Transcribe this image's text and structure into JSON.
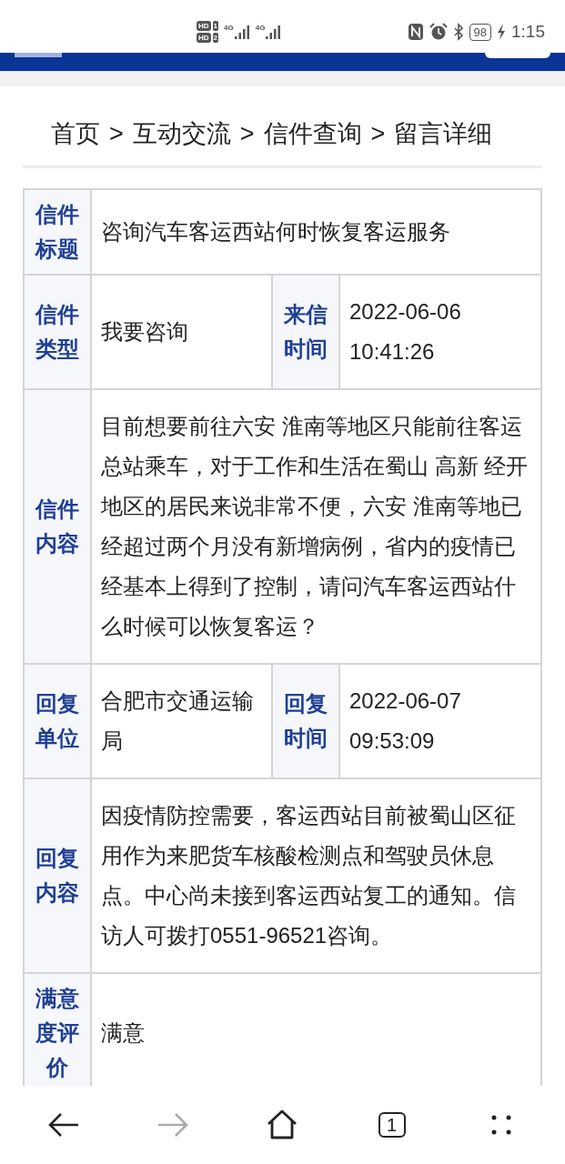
{
  "status_bar": {
    "sims": [
      {
        "label": "HD",
        "slot": "1"
      },
      {
        "label": "HD",
        "slot": "2"
      }
    ],
    "networks": [
      "4G",
      "4G"
    ],
    "battery": "98",
    "charging": true,
    "time": "1:15"
  },
  "breadcrumb": {
    "items": [
      "首页",
      "互动交流",
      "信件查询",
      "留言详细"
    ],
    "separator": ">"
  },
  "details": {
    "rows": [
      {
        "cells": [
          {
            "kind": "label",
            "text": "信件标题"
          },
          {
            "kind": "value",
            "text": "咨询汽车客运西站何时恢复客运服务"
          }
        ]
      },
      {
        "cells": [
          {
            "kind": "label",
            "text": "信件类型"
          },
          {
            "kind": "value",
            "text": "我要咨询"
          },
          {
            "kind": "label",
            "text": "来信时间"
          },
          {
            "kind": "datetime",
            "text": "2022-06-06 10:41:26"
          }
        ]
      },
      {
        "cells": [
          {
            "kind": "label",
            "text": "信件内容"
          },
          {
            "kind": "value",
            "text": "目前想要前往六安 淮南等地区只能前往客运总站乘车，对于工作和生活在蜀山 高新 经开地区的居民来说非常不便，六安 淮南等地已经超过两个月没有新增病例，省内的疫情已经基本上得到了控制，请问汽车客运西站什么时候可以恢复客运？"
          }
        ]
      },
      {
        "cells": [
          {
            "kind": "label",
            "text": "回复单位"
          },
          {
            "kind": "value",
            "text": "合肥市交通运输局"
          },
          {
            "kind": "label",
            "text": "回复时间"
          },
          {
            "kind": "datetime",
            "text": "2022-06-07 09:53:09"
          }
        ]
      },
      {
        "cells": [
          {
            "kind": "label",
            "text": "回复内容"
          },
          {
            "kind": "value",
            "text": "因疫情防控需要，客运西站目前被蜀山区征用作为来肥货车核酸检测点和驾驶员休息点。中心尚未接到客运西站复工的通知。信访人可拨打0551-96521咨询。"
          }
        ]
      },
      {
        "cells": [
          {
            "kind": "label",
            "text": "满意度评价"
          },
          {
            "kind": "value",
            "text": "满意"
          }
        ]
      }
    ]
  },
  "toolbar": {
    "items": [
      {
        "kind": "back",
        "disabled": false
      },
      {
        "kind": "forward",
        "disabled": true
      },
      {
        "kind": "home",
        "disabled": false
      },
      {
        "kind": "tabs",
        "disabled": false,
        "count": "1"
      },
      {
        "kind": "more",
        "disabled": false
      }
    ]
  }
}
